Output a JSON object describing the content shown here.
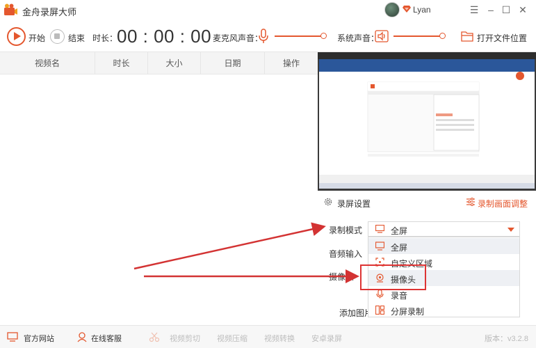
{
  "titlebar": {
    "app_name": "金舟录屏大师",
    "username": "Lyan",
    "controls": [
      "☰",
      "–",
      "☐",
      "✕"
    ]
  },
  "toolbar": {
    "start_label": "开始",
    "stop_label": "结束",
    "duration_label": "时长：",
    "timer": "00 : 00 : 00",
    "mic_label": "麦克风声音：",
    "system_label": "系统声音：",
    "open_folder_label": "打开文件位置"
  },
  "table": {
    "columns": [
      "视频名",
      "时长",
      "大小",
      "日期",
      "操作"
    ]
  },
  "settings": {
    "title": "录屏设置",
    "adjust_label": "录制画面调整",
    "mode_label": "录制模式",
    "audio_label": "音频输入",
    "camera_label": "摄像头",
    "add_image_label": "添加图片",
    "mode_value": "全屏",
    "options": [
      {
        "label": "全屏",
        "icon": "monitor-icon"
      },
      {
        "label": "自定义区域",
        "icon": "region-icon"
      },
      {
        "label": "摄像头",
        "icon": "camera-icon"
      },
      {
        "label": "录音",
        "icon": "mic-icon"
      },
      {
        "label": "分屏录制",
        "icon": "split-screen-icon"
      }
    ]
  },
  "bottombar": {
    "website": "官方网站",
    "support": "在线客服",
    "tool1": "视频剪切",
    "tool2": "视频压缩",
    "tool3": "视频转换",
    "tool4": "安卓录屏",
    "version": "版本：v3.2.8"
  },
  "colors": {
    "accent": "#e4572e",
    "annotation_red": "#d33333"
  }
}
